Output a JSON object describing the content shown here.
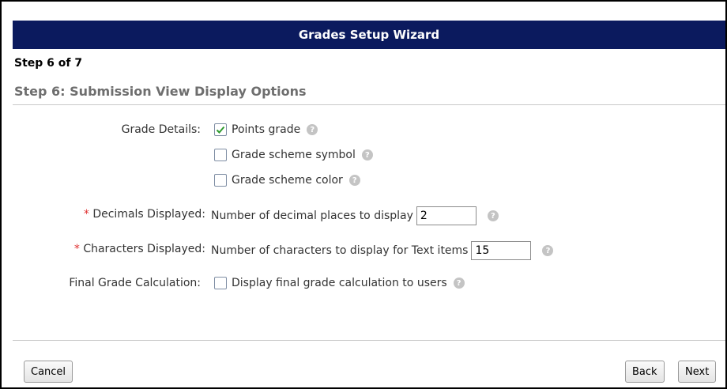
{
  "wizard": {
    "title": "Grades Setup Wizard",
    "step_label": "Step 6 of 7",
    "step_title": "Step 6: Submission View Display Options"
  },
  "grade_details": {
    "label": "Grade Details:",
    "options": [
      {
        "label": "Points grade",
        "checked": true
      },
      {
        "label": "Grade scheme symbol",
        "checked": false
      },
      {
        "label": "Grade scheme color",
        "checked": false
      }
    ]
  },
  "decimals": {
    "required_mark": "*",
    "label": "Decimals Displayed:",
    "description": "Number of decimal places to display",
    "value": "2"
  },
  "characters": {
    "required_mark": "*",
    "label": "Characters Displayed:",
    "description": "Number of characters to display for Text items",
    "value": "15"
  },
  "final_grade": {
    "label": "Final Grade Calculation:",
    "option_label": "Display final grade calculation to users",
    "checked": false
  },
  "buttons": {
    "cancel": "Cancel",
    "back": "Back",
    "next": "Next"
  },
  "icons": {
    "help": "help-icon",
    "check": "check-icon"
  },
  "colors": {
    "titlebar": "#0b1a5e",
    "required": "#e03030",
    "check": "#2f9b2f"
  }
}
